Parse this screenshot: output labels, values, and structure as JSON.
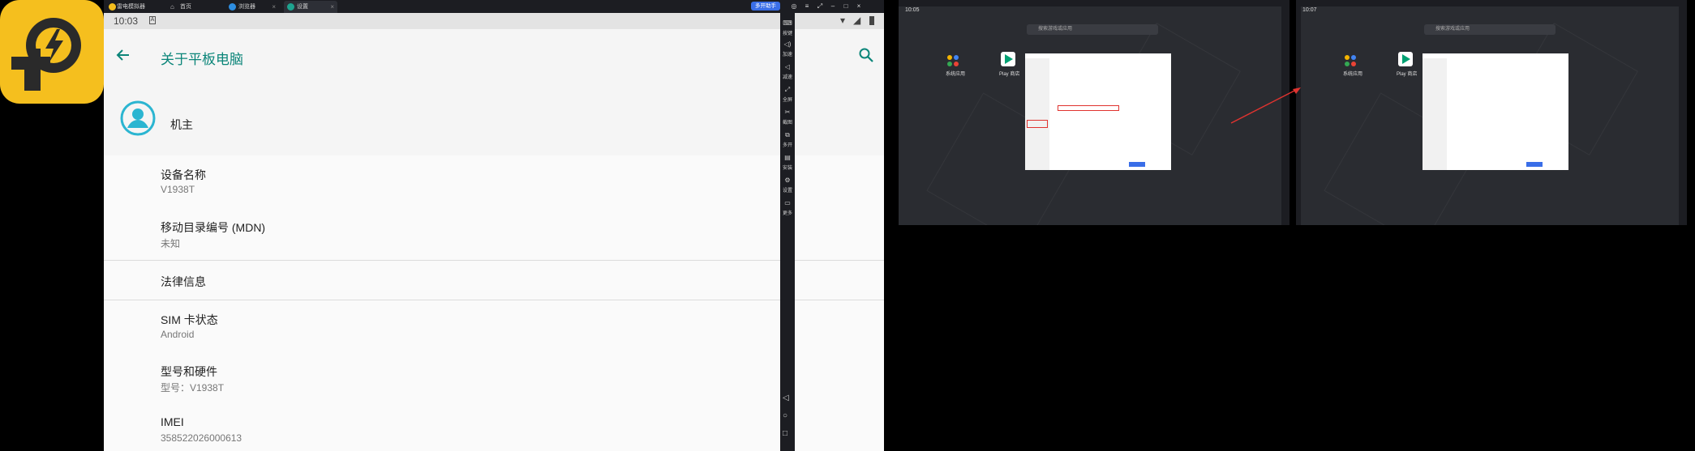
{
  "titlebar": {
    "app_title": "雷电模拟器",
    "tabs": [
      {
        "label": "首页"
      },
      {
        "label": "浏览器"
      },
      {
        "label": "设置"
      }
    ],
    "badge": "多开助手"
  },
  "status": {
    "time": "10:03"
  },
  "appbar": {
    "title": "关于平板电脑"
  },
  "owner": {
    "name": "机主"
  },
  "items": [
    {
      "title": "设备名称",
      "subtitle": "V1938T"
    },
    {
      "title": "移动目录编号 (MDN)",
      "subtitle": "未知"
    },
    {
      "title": "法律信息",
      "subtitle": ""
    },
    {
      "title": "SIM 卡状态",
      "subtitle": "Android"
    },
    {
      "title": "型号和硬件",
      "subtitle": "型号：V1938T"
    },
    {
      "title": "IMEI",
      "subtitle": "358522026000613"
    }
  ],
  "toolbar_labels": [
    "按键",
    "加速",
    "减速",
    "全屏",
    "截图",
    "多开",
    "安装",
    "设置",
    "更多"
  ],
  "thumb1": {
    "time": "10:05",
    "search_placeholder": "搜索游戏或应用",
    "apps": [
      "系统应用",
      "Play 商店"
    ]
  },
  "thumb2": {
    "time": "10:07",
    "search_placeholder": "搜索游戏或应用",
    "apps": [
      "系统应用",
      "Play 商店"
    ]
  },
  "colors": {
    "accent": "#0b8579",
    "logo_yellow": "#f5bf1e",
    "highlight_red": "#e0332f",
    "tab_blue": "#3a6ee8"
  }
}
